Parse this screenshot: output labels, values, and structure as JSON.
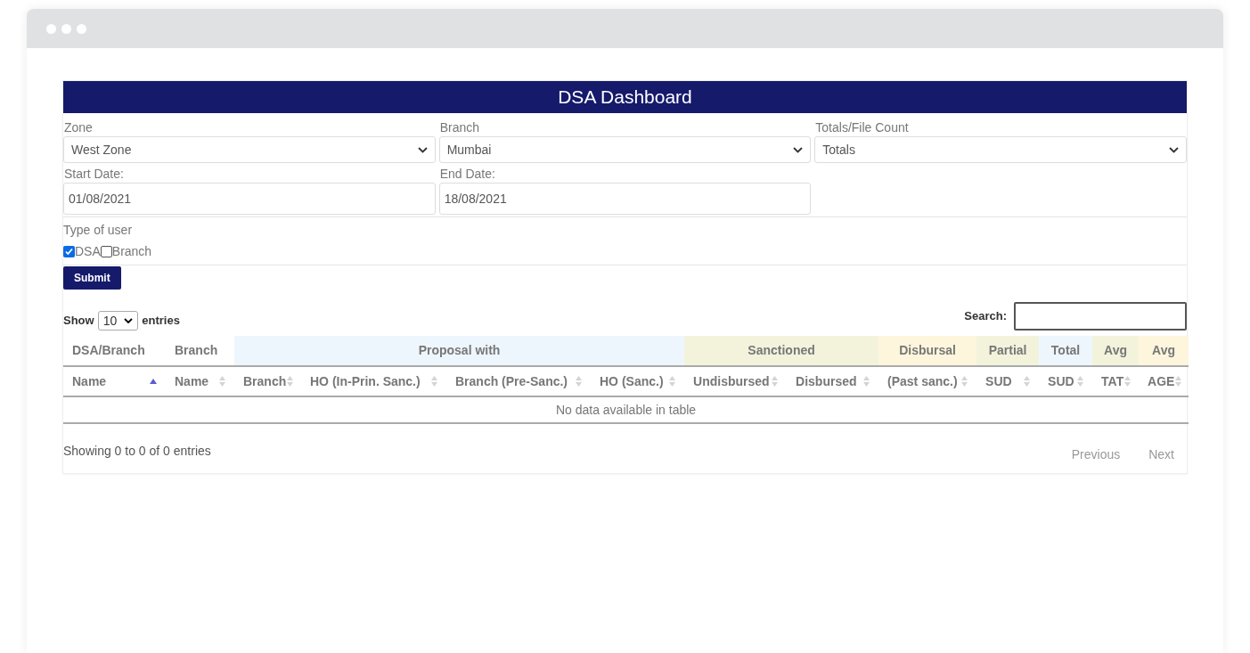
{
  "title": "DSA Dashboard",
  "filters": [
    {
      "label": "Zone",
      "value": "West Zone",
      "kind": "select"
    },
    {
      "label": "Branch",
      "value": "Mumbai",
      "kind": "select"
    },
    {
      "label": "Totals/File Count",
      "value": "Totals",
      "kind": "select"
    },
    {
      "label": "Start Date:",
      "value": "01/08/2021",
      "kind": "date"
    },
    {
      "label": "End Date:",
      "value": "18/08/2021",
      "kind": "date"
    }
  ],
  "user_type": {
    "label": "Type of user",
    "options": [
      {
        "label": "DSA",
        "checked": true
      },
      {
        "label": "Branch",
        "checked": false
      }
    ]
  },
  "submit": "Submit",
  "length": {
    "prefix": "Show",
    "value": "10",
    "suffix": "entries"
  },
  "search": {
    "label": "Search:"
  },
  "table": {
    "groups": [
      {
        "label": "DSA/Branch",
        "color": "#ffffff",
        "columns": [
          {
            "label": "Name",
            "sorted": true
          }
        ]
      },
      {
        "label": "Branch",
        "color": "#ffffff",
        "columns": [
          {
            "label": "Name",
            "sorted": false
          }
        ]
      },
      {
        "label": "Proposal with",
        "color": "#eef6fd",
        "columns": [
          {
            "label": "Branch",
            "sorted": false
          },
          {
            "label": "HO (In-Prin. Sanc.)",
            "sorted": false
          },
          {
            "label": "Branch (Pre-Sanc.)",
            "sorted": false
          },
          {
            "label": "HO (Sanc.)",
            "sorted": false
          }
        ]
      },
      {
        "label": "Sanctioned",
        "color": "#f3f3dc",
        "columns": [
          {
            "label": "Undisbursed",
            "sorted": false
          },
          {
            "label": "Disbursed",
            "sorted": false
          }
        ]
      },
      {
        "label": "Disbursal",
        "color": "#fdf6dc",
        "columns": [
          {
            "label": "(Past sanc.)",
            "sorted": false
          }
        ]
      },
      {
        "label": "Partial",
        "color": "#f3f3dc",
        "columns": [
          {
            "label": "SUD",
            "sorted": false
          }
        ]
      },
      {
        "label": "Total",
        "color": "#eef6fd",
        "columns": [
          {
            "label": "SUD",
            "sorted": false
          }
        ]
      },
      {
        "label": "Avg",
        "color": "#f3f3dc",
        "columns": [
          {
            "label": "TAT",
            "sorted": false
          }
        ]
      },
      {
        "label": "Avg",
        "color": "#fdf6dc",
        "columns": [
          {
            "label": "AGE",
            "sorted": false
          }
        ]
      }
    ],
    "empty": "No data available in table"
  },
  "info": "Showing 0 to 0 of 0 entries",
  "pagination": [
    {
      "label": "Previous",
      "disabled": true
    },
    {
      "label": "Next",
      "disabled": true
    }
  ]
}
